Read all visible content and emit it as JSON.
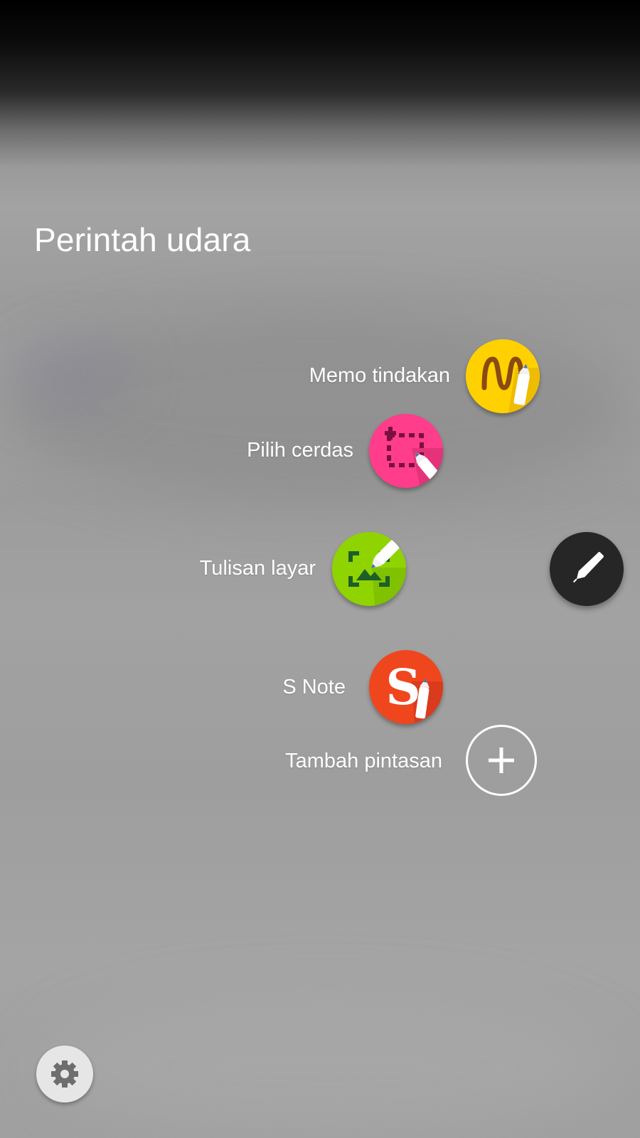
{
  "screen": {
    "title": "Perintah udara"
  },
  "commands": [
    {
      "label": "Memo tindakan",
      "icon": "action-memo-icon",
      "color": "#FFD100"
    },
    {
      "label": "Pilih cerdas",
      "icon": "smart-select-icon",
      "color": "#FF3D8B"
    },
    {
      "label": "Tulisan layar",
      "icon": "screen-write-icon",
      "color": "#8FD400"
    },
    {
      "label": "S Note",
      "icon": "s-note-icon",
      "color": "#F0461E"
    },
    {
      "label": "Tambah pintasan",
      "icon": "plus-icon",
      "color": "#FFFFFF"
    }
  ],
  "pen_button": {
    "icon": "pen-icon",
    "color": "#262626"
  },
  "settings_button": {
    "icon": "gear-icon",
    "color": "#E6E6E6"
  },
  "s_note_letter": "S"
}
